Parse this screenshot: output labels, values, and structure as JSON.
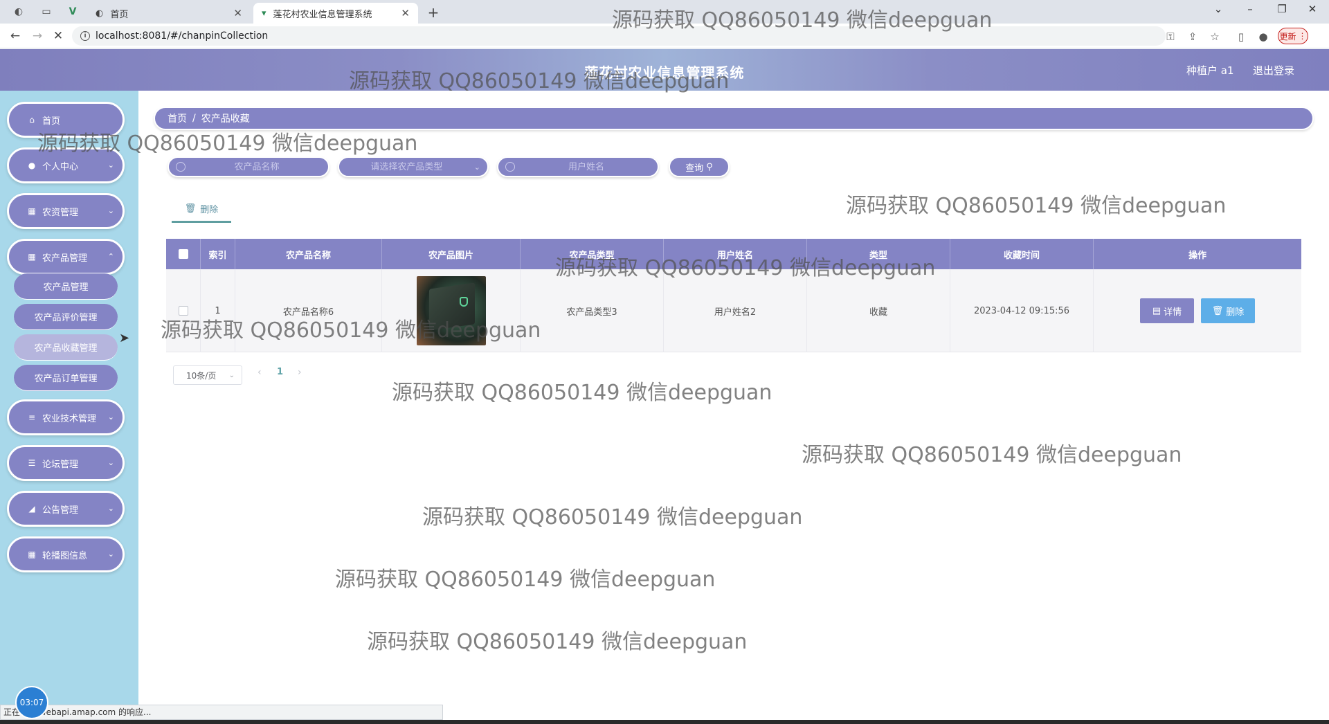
{
  "browser": {
    "tabs": [
      {
        "title": "首页",
        "favicon": "globe-icon",
        "active": false
      },
      {
        "title": "莲花村农业信息管理系统",
        "favicon": "vue-icon",
        "active": true
      }
    ],
    "new_tab": "+",
    "window_controls": {
      "dropdown": "⌄",
      "minimize": "–",
      "restore": "❐",
      "close": "✕"
    },
    "url": "localhost:8081/#/chanpinCollection",
    "update_label": "更新",
    "status_text": "正在等待 webapi.amap.com 的响应...",
    "clock": "03:07"
  },
  "header": {
    "title": "莲花村农业信息管理系统",
    "user": "种植户 a1",
    "logout": "退出登录"
  },
  "sidebar": {
    "items": [
      {
        "label": "首页",
        "icon": "home-icon",
        "glyph": "⌂"
      },
      {
        "label": "个人中心",
        "icon": "user-icon",
        "glyph": "●"
      },
      {
        "label": "农资管理",
        "icon": "grid-icon",
        "glyph": "▦"
      },
      {
        "label": "农产品管理",
        "icon": "grid-icon",
        "glyph": "▦"
      },
      {
        "label": "农业技术管理",
        "icon": "sliders-icon",
        "glyph": "≡"
      },
      {
        "label": "论坛管理",
        "icon": "list-icon",
        "glyph": "☰"
      },
      {
        "label": "公告管理",
        "icon": "megaphone-icon",
        "glyph": "◢"
      },
      {
        "label": "轮播图信息",
        "icon": "grid-icon",
        "glyph": "▦"
      }
    ],
    "subitems": [
      "农产品管理",
      "农产品评价管理",
      "农产品收藏管理",
      "农产品订单管理"
    ],
    "active_subitem": "农产品收藏管理"
  },
  "breadcrumb": {
    "home": "首页",
    "separator": "/",
    "current": "农产品收藏"
  },
  "search": {
    "product_name_placeholder": "农产品名称",
    "product_type_placeholder": "请选择农产品类型",
    "user_name_placeholder": "用户姓名",
    "query_label": "查询"
  },
  "actions": {
    "delete_label": "删除"
  },
  "table": {
    "columns": [
      "索引",
      "农产品名称",
      "农产品图片",
      "农产品类型",
      "用户姓名",
      "类型",
      "收藏时间",
      "操作"
    ],
    "rows": [
      {
        "index": "1",
        "product_name": "农产品名称6",
        "product_image": "laptop-photo",
        "product_type": "农产品类型3",
        "user_name": "用户姓名2",
        "type": "收藏",
        "time": "2023-04-12 09:15:56",
        "detail_label": "详情",
        "delete_label": "删除"
      }
    ]
  },
  "pagination": {
    "page_size": "10条/页",
    "current_page": "1"
  },
  "watermark_text": "源码获取 QQ86050149 微信deepguan"
}
